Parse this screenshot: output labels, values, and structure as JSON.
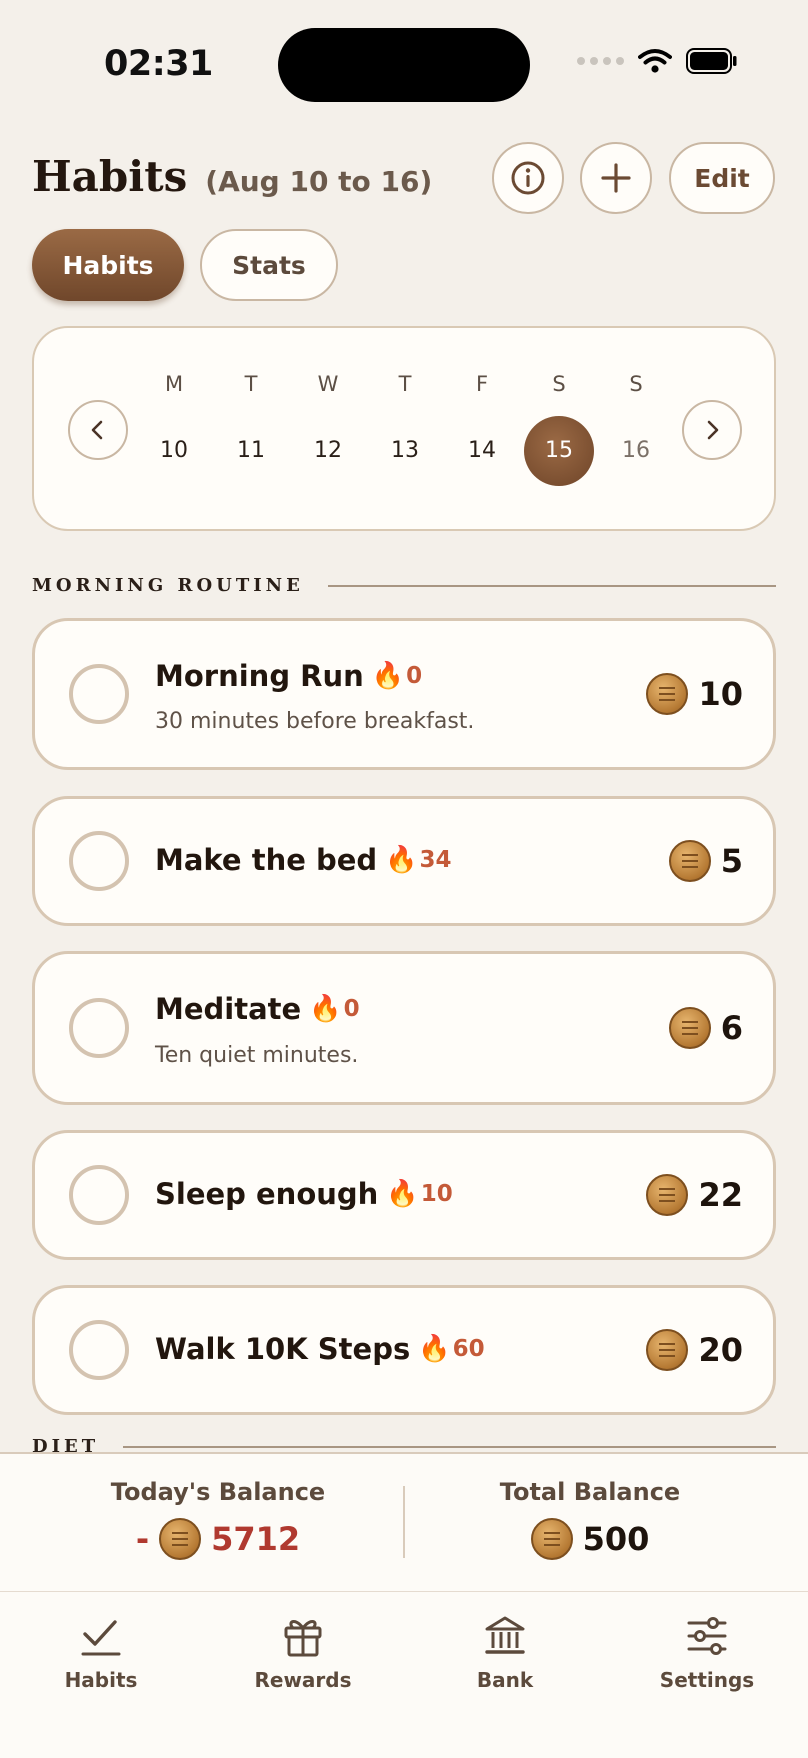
{
  "status_bar": {
    "time": "02:31"
  },
  "header": {
    "title": "Habits",
    "date_range": "(Aug 10 to 16)",
    "edit_label": "Edit"
  },
  "segments": {
    "habits": "Habits",
    "stats": "Stats",
    "selected": "Habits"
  },
  "calendar": {
    "days": [
      {
        "dow": "M",
        "date": "10"
      },
      {
        "dow": "T",
        "date": "11"
      },
      {
        "dow": "W",
        "date": "12"
      },
      {
        "dow": "T",
        "date": "13"
      },
      {
        "dow": "F",
        "date": "14"
      },
      {
        "dow": "S",
        "date": "15"
      },
      {
        "dow": "S",
        "date": "16"
      }
    ],
    "selected_date": "15"
  },
  "sections": {
    "morning": "MORNING ROUTINE",
    "diet": "DIET"
  },
  "habits": [
    {
      "name": "Morning Run",
      "streak": "0",
      "desc": "30 minutes before breakfast.",
      "coins": "10"
    },
    {
      "name": "Make the bed",
      "streak": "34",
      "desc": "",
      "coins": "5"
    },
    {
      "name": "Meditate",
      "streak": "0",
      "desc": "Ten quiet minutes.",
      "coins": "6"
    },
    {
      "name": "Sleep enough",
      "streak": "10",
      "desc": "",
      "coins": "22"
    },
    {
      "name": "Walk 10K Steps",
      "streak": "60",
      "desc": "",
      "coins": "20"
    }
  ],
  "balance": {
    "today_label": "Today's Balance",
    "today_sign": "-",
    "today_value": "5712",
    "total_label": "Total Balance",
    "total_value": "500"
  },
  "tabs": [
    {
      "label": "Habits",
      "icon": "checkmark-icon"
    },
    {
      "label": "Rewards",
      "icon": "gift-icon"
    },
    {
      "label": "Bank",
      "icon": "bank-icon"
    },
    {
      "label": "Settings",
      "icon": "sliders-icon"
    }
  ],
  "colors": {
    "background": "#f4f0ea",
    "accent_brown": "#7a4d30",
    "negative_red": "#b0392f",
    "streak_orange": "#c45a38"
  }
}
